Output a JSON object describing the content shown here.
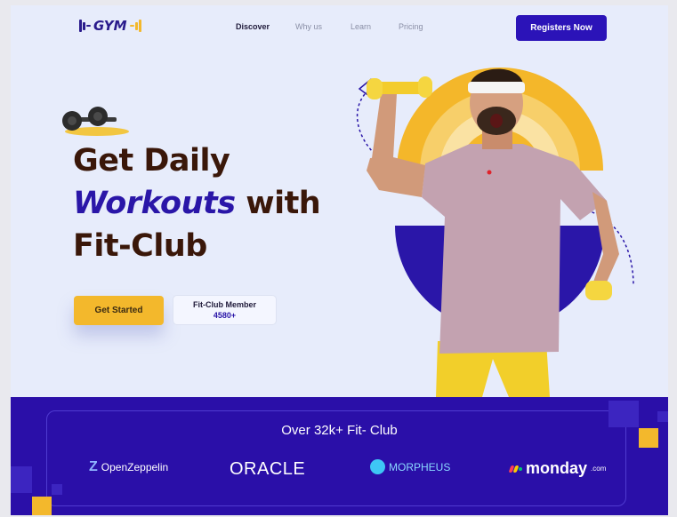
{
  "header": {
    "logo_text": "GYM",
    "nav": [
      "Discover",
      "Why us",
      "Learn",
      "Pricing"
    ],
    "register_label": "Registers Now"
  },
  "hero": {
    "line1": "Get Daily",
    "line2_accent": "Workouts",
    "line2_rest": "with",
    "line3": "Fit-Club",
    "cta_label": "Get Started",
    "member_title": "Fit-Club Member",
    "member_count": "4580+"
  },
  "band": {
    "title": "Over 32k+  Fit- Club",
    "brands": [
      "OpenZeppelin",
      "ORACLE",
      "MORPHEUS",
      "monday",
      ".com"
    ]
  },
  "colors": {
    "brand_blue": "#2b13b8",
    "accent_yellow": "#f3b82c",
    "heading_brown": "#3a1709",
    "background": "#e7ecfb"
  }
}
